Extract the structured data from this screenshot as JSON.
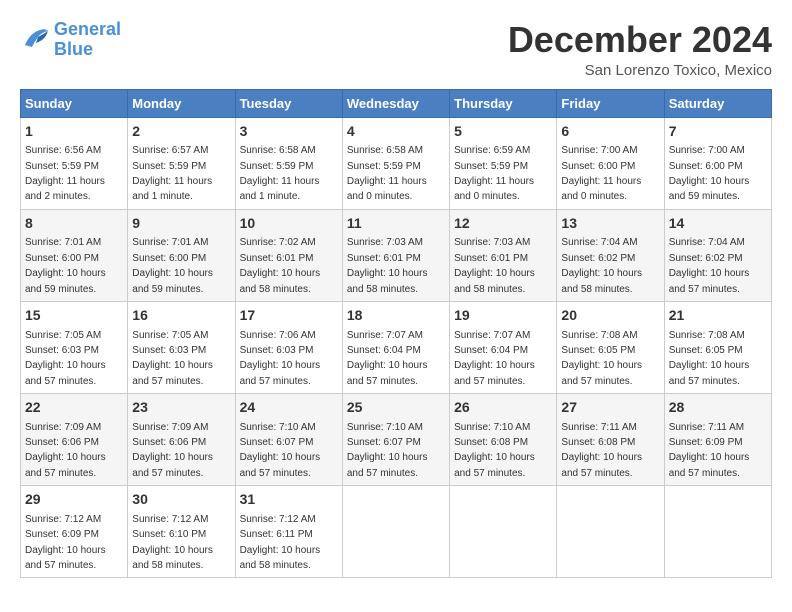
{
  "header": {
    "logo_line1": "General",
    "logo_line2": "Blue",
    "month": "December 2024",
    "location": "San Lorenzo Toxico, Mexico"
  },
  "days_of_week": [
    "Sunday",
    "Monday",
    "Tuesday",
    "Wednesday",
    "Thursday",
    "Friday",
    "Saturday"
  ],
  "weeks": [
    [
      {
        "day": "1",
        "sunrise": "6:56 AM",
        "sunset": "5:59 PM",
        "daylight": "11 hours and 2 minutes."
      },
      {
        "day": "2",
        "sunrise": "6:57 AM",
        "sunset": "5:59 PM",
        "daylight": "11 hours and 1 minute."
      },
      {
        "day": "3",
        "sunrise": "6:58 AM",
        "sunset": "5:59 PM",
        "daylight": "11 hours and 1 minute."
      },
      {
        "day": "4",
        "sunrise": "6:58 AM",
        "sunset": "5:59 PM",
        "daylight": "11 hours and 0 minutes."
      },
      {
        "day": "5",
        "sunrise": "6:59 AM",
        "sunset": "5:59 PM",
        "daylight": "11 hours and 0 minutes."
      },
      {
        "day": "6",
        "sunrise": "7:00 AM",
        "sunset": "6:00 PM",
        "daylight": "11 hours and 0 minutes."
      },
      {
        "day": "7",
        "sunrise": "7:00 AM",
        "sunset": "6:00 PM",
        "daylight": "10 hours and 59 minutes."
      }
    ],
    [
      {
        "day": "8",
        "sunrise": "7:01 AM",
        "sunset": "6:00 PM",
        "daylight": "10 hours and 59 minutes."
      },
      {
        "day": "9",
        "sunrise": "7:01 AM",
        "sunset": "6:00 PM",
        "daylight": "10 hours and 59 minutes."
      },
      {
        "day": "10",
        "sunrise": "7:02 AM",
        "sunset": "6:01 PM",
        "daylight": "10 hours and 58 minutes."
      },
      {
        "day": "11",
        "sunrise": "7:03 AM",
        "sunset": "6:01 PM",
        "daylight": "10 hours and 58 minutes."
      },
      {
        "day": "12",
        "sunrise": "7:03 AM",
        "sunset": "6:01 PM",
        "daylight": "10 hours and 58 minutes."
      },
      {
        "day": "13",
        "sunrise": "7:04 AM",
        "sunset": "6:02 PM",
        "daylight": "10 hours and 58 minutes."
      },
      {
        "day": "14",
        "sunrise": "7:04 AM",
        "sunset": "6:02 PM",
        "daylight": "10 hours and 57 minutes."
      }
    ],
    [
      {
        "day": "15",
        "sunrise": "7:05 AM",
        "sunset": "6:03 PM",
        "daylight": "10 hours and 57 minutes."
      },
      {
        "day": "16",
        "sunrise": "7:05 AM",
        "sunset": "6:03 PM",
        "daylight": "10 hours and 57 minutes."
      },
      {
        "day": "17",
        "sunrise": "7:06 AM",
        "sunset": "6:03 PM",
        "daylight": "10 hours and 57 minutes."
      },
      {
        "day": "18",
        "sunrise": "7:07 AM",
        "sunset": "6:04 PM",
        "daylight": "10 hours and 57 minutes."
      },
      {
        "day": "19",
        "sunrise": "7:07 AM",
        "sunset": "6:04 PM",
        "daylight": "10 hours and 57 minutes."
      },
      {
        "day": "20",
        "sunrise": "7:08 AM",
        "sunset": "6:05 PM",
        "daylight": "10 hours and 57 minutes."
      },
      {
        "day": "21",
        "sunrise": "7:08 AM",
        "sunset": "6:05 PM",
        "daylight": "10 hours and 57 minutes."
      }
    ],
    [
      {
        "day": "22",
        "sunrise": "7:09 AM",
        "sunset": "6:06 PM",
        "daylight": "10 hours and 57 minutes."
      },
      {
        "day": "23",
        "sunrise": "7:09 AM",
        "sunset": "6:06 PM",
        "daylight": "10 hours and 57 minutes."
      },
      {
        "day": "24",
        "sunrise": "7:10 AM",
        "sunset": "6:07 PM",
        "daylight": "10 hours and 57 minutes."
      },
      {
        "day": "25",
        "sunrise": "7:10 AM",
        "sunset": "6:07 PM",
        "daylight": "10 hours and 57 minutes."
      },
      {
        "day": "26",
        "sunrise": "7:10 AM",
        "sunset": "6:08 PM",
        "daylight": "10 hours and 57 minutes."
      },
      {
        "day": "27",
        "sunrise": "7:11 AM",
        "sunset": "6:08 PM",
        "daylight": "10 hours and 57 minutes."
      },
      {
        "day": "28",
        "sunrise": "7:11 AM",
        "sunset": "6:09 PM",
        "daylight": "10 hours and 57 minutes."
      }
    ],
    [
      {
        "day": "29",
        "sunrise": "7:12 AM",
        "sunset": "6:09 PM",
        "daylight": "10 hours and 57 minutes."
      },
      {
        "day": "30",
        "sunrise": "7:12 AM",
        "sunset": "6:10 PM",
        "daylight": "10 hours and 58 minutes."
      },
      {
        "day": "31",
        "sunrise": "7:12 AM",
        "sunset": "6:11 PM",
        "daylight": "10 hours and 58 minutes."
      },
      null,
      null,
      null,
      null
    ]
  ]
}
